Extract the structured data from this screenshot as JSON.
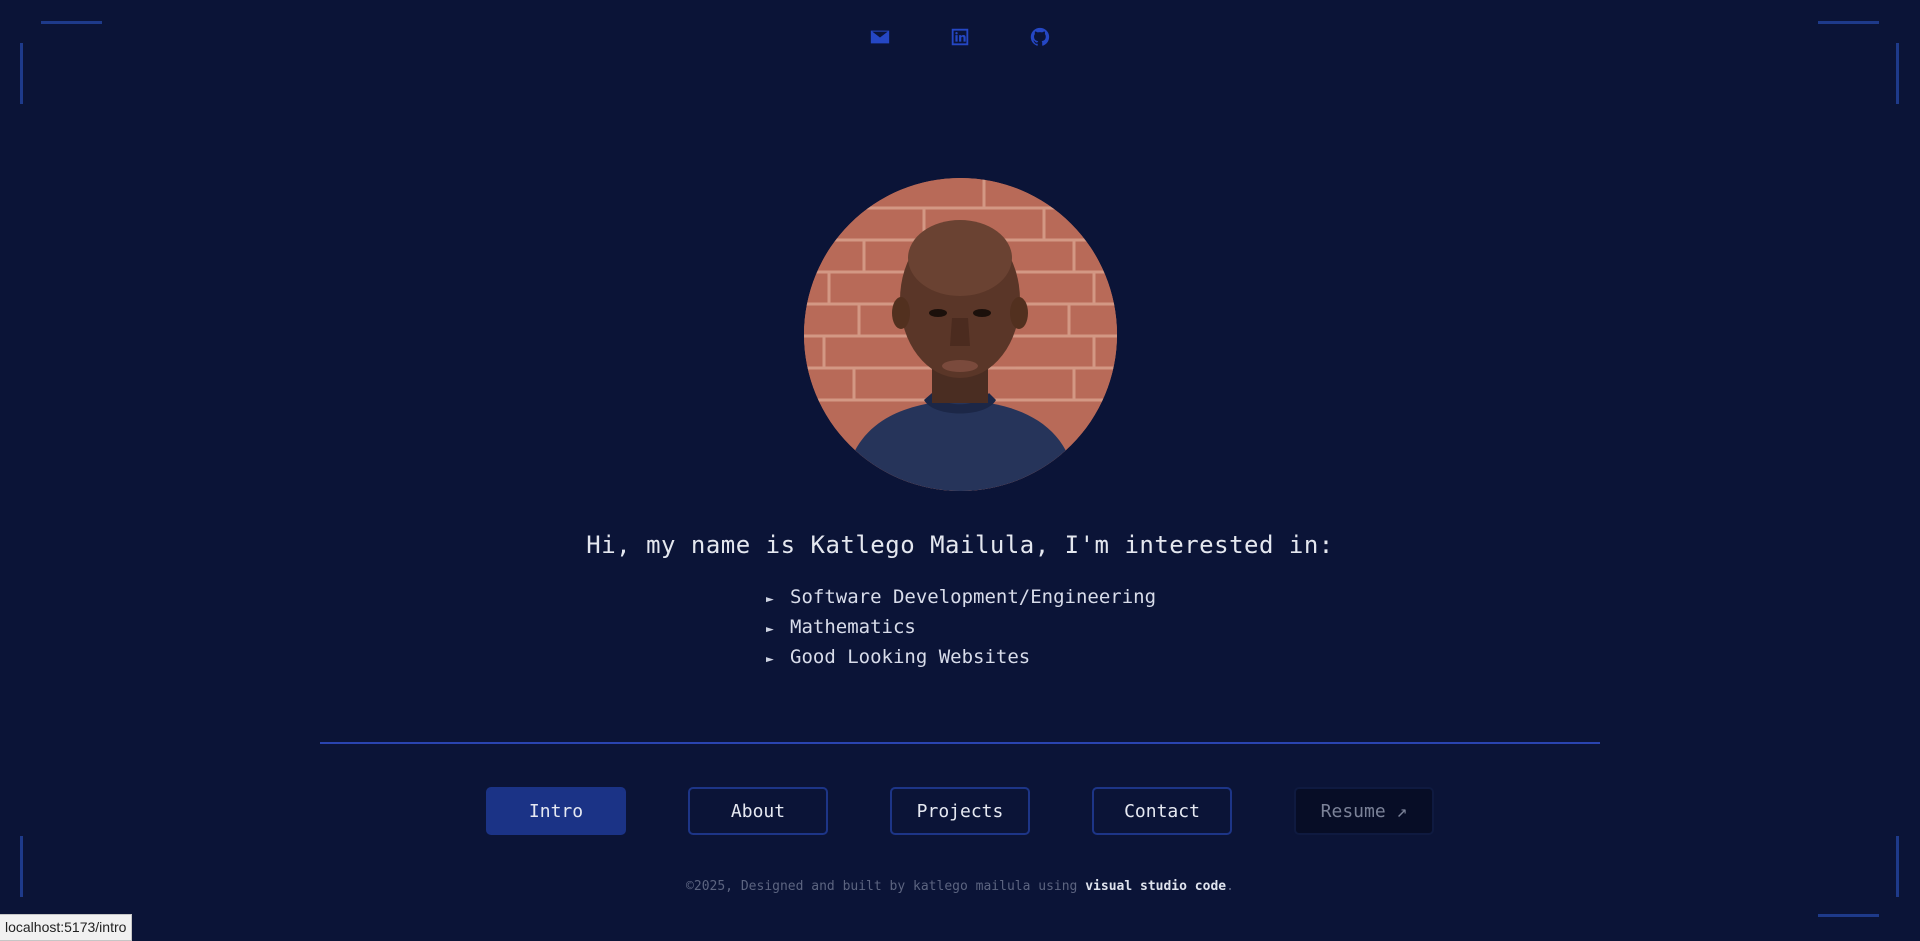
{
  "social": {
    "icons": [
      {
        "name": "mail-icon"
      },
      {
        "name": "linkedin-icon"
      },
      {
        "name": "github-icon"
      }
    ],
    "icon_color": "#2547c4"
  },
  "intro": {
    "headline": "Hi, my name is Katlego Mailula, I'm interested in:",
    "bullet": "►",
    "interests": [
      "Software Development/Engineering",
      "Mathematics",
      "Good Looking Websites"
    ]
  },
  "nav": {
    "items": [
      {
        "label": "Intro",
        "active": true
      },
      {
        "label": "About",
        "active": false
      },
      {
        "label": "Projects",
        "active": false
      },
      {
        "label": "Contact",
        "active": false
      },
      {
        "label": "Resume ↗",
        "active": false
      }
    ]
  },
  "footer": {
    "prefix": "©2025, Designed and built by katlego mailula using ",
    "tool": "visual studio code",
    "suffix": "."
  },
  "status_bar": {
    "url": "localhost:5173/intro"
  },
  "colors": {
    "background": "#0b1437",
    "accent": "#1b3386",
    "border": "#1d3587"
  }
}
